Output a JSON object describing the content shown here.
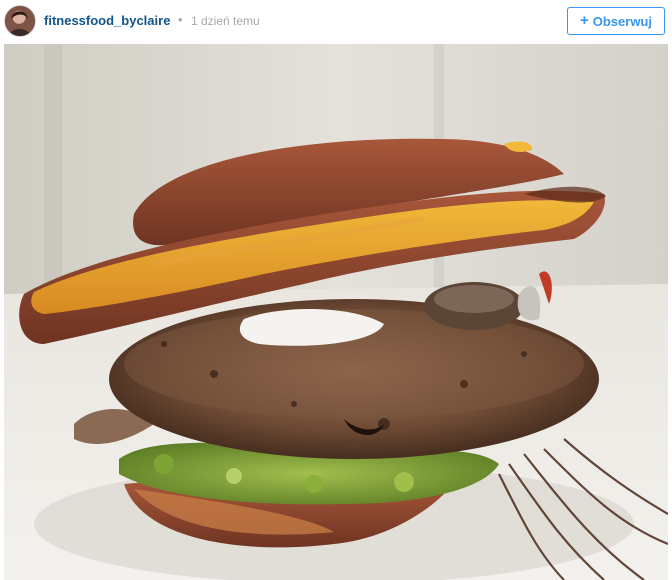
{
  "header": {
    "username": "fitnessfood_byclaire",
    "separator": "•",
    "timestamp": "1 dzień temu",
    "follow_label": "Obserwuj",
    "follow_icon": "plus-icon"
  },
  "avatar": {
    "icon": "user-avatar"
  },
  "colors": {
    "username": "#125688",
    "timestamp": "#a5a7aa",
    "follow_accent": "#3897f0"
  }
}
